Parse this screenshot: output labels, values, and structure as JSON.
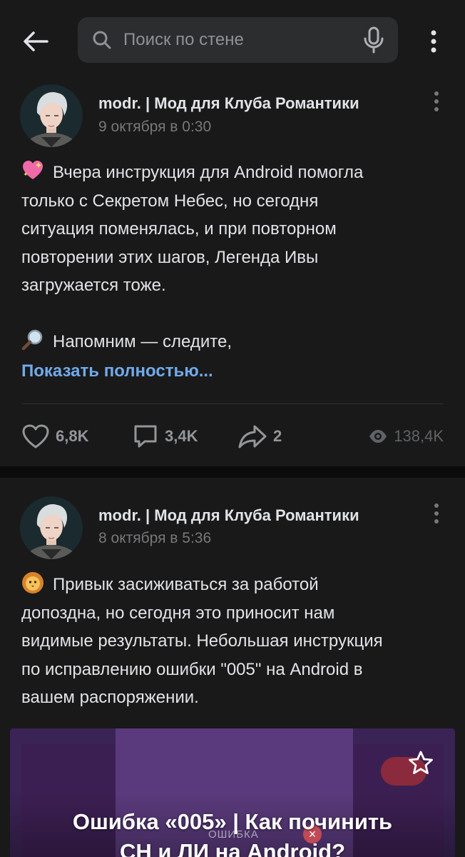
{
  "search": {
    "placeholder": "Поиск по стене"
  },
  "posts": [
    {
      "author": "modr. | Мод для Клуба Романтики",
      "date": "9 октября в 0:30",
      "emoji": "sparkling-heart",
      "text_lines": [
        "Вчера инструкция для Android помогла",
        "только с Секретом Небес, но сегодня",
        "ситуация поменялась, и при повторном",
        "повторении этих шагов, Легенда Ивы",
        "загружается тоже."
      ],
      "text_after": "Напомним — следите,",
      "emoji_after": "magnifying-glass",
      "show_more": "Показать полностью...",
      "likes": "6,8K",
      "comments": "3,4K",
      "shares": "2",
      "views": "138,4K"
    },
    {
      "author": "modr. | Мод для Клуба Романтики",
      "date": "8 октября в 5:36",
      "emoji": "lion-face",
      "text_lines": [
        "Привык засиживаться за работой",
        "допоздна, но сегодня это приносит нам",
        "видимые результаты. Небольшая инструкция",
        "по исправлению ошибки \"005\" на Android в",
        "вашем распоряжении."
      ],
      "attachment": {
        "title_line1": "Ошибка «005» | Как починить",
        "title_line2": "СН и ЛИ на Android?",
        "inner_label": "ОШИБКА"
      }
    }
  ],
  "colors": {
    "background": "#0b0b0c",
    "card": "#19191a",
    "link": "#71aaeb",
    "secondary_text": "#76787a"
  }
}
